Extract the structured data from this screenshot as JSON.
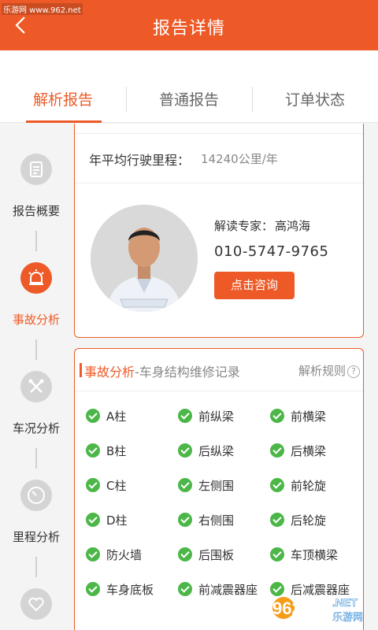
{
  "watermark_top": "乐游网 www.962.net",
  "header": {
    "title": "报告详情"
  },
  "tabs": [
    {
      "label": "解析报告",
      "active": true
    },
    {
      "label": "普通报告",
      "active": false
    },
    {
      "label": "订单状态",
      "active": false
    }
  ],
  "sidebar": [
    {
      "label": "报告概要",
      "icon": "document-icon",
      "active": false
    },
    {
      "label": "事故分析",
      "icon": "alarm-icon",
      "active": true
    },
    {
      "label": "车况分析",
      "icon": "tools-icon",
      "active": false
    },
    {
      "label": "里程分析",
      "icon": "gauge-icon",
      "active": false
    },
    {
      "label": "",
      "icon": "heart-icon",
      "active": false
    }
  ],
  "mileage": {
    "label": "年平均行驶里程：",
    "value": "14240公里/年"
  },
  "expert": {
    "label": "解读专家：",
    "name": "高鸿海",
    "phone": "010-5747-9765",
    "consult_button": "点击咨询"
  },
  "accident": {
    "title": "事故分析",
    "subtitle": "-车身结构维修记录",
    "rules_link": "解析规则",
    "items": [
      [
        "A柱",
        "前纵梁",
        "前横梁"
      ],
      [
        "B柱",
        "后纵梁",
        "后横梁"
      ],
      [
        "C柱",
        "左侧围",
        "前轮旋"
      ],
      [
        "D柱",
        "右侧围",
        "后轮旋"
      ],
      [
        "防火墙",
        "后围板",
        "车顶横梁"
      ],
      [
        "车身底板",
        "前减震器座",
        "后减震器座"
      ]
    ]
  },
  "watermark_logo": {
    "text": "962",
    "sub": "乐游网",
    "net": ".NET"
  },
  "colors": {
    "accent": "#ee5a27",
    "check": "#4cb748"
  }
}
